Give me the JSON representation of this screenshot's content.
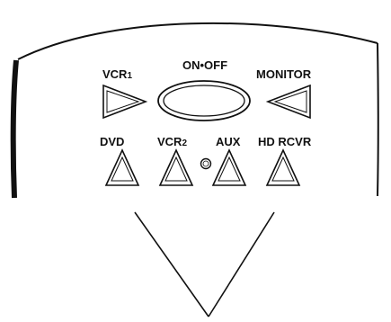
{
  "colors": {
    "ink": "#111111",
    "paper": "#ffffff"
  },
  "remote": {
    "top_row": {
      "left_label_main": "VCR",
      "left_label_sub": "1",
      "center_label": "ON•OFF",
      "right_label": "MONITOR"
    },
    "bottom_row": {
      "label_1": "DVD",
      "label_2_main": "VCR",
      "label_2_sub": "2",
      "label_3": "AUX",
      "label_4": "HD RCVR"
    }
  },
  "buttons": [
    {
      "name": "vcr1-button",
      "icon": "triangle-right"
    },
    {
      "name": "on-off-button",
      "icon": "oval"
    },
    {
      "name": "monitor-button",
      "icon": "triangle-left"
    },
    {
      "name": "dvd-button",
      "icon": "triangle-up"
    },
    {
      "name": "vcr2-button",
      "icon": "triangle-up"
    },
    {
      "name": "indicator-led",
      "icon": "circle"
    },
    {
      "name": "aux-button",
      "icon": "triangle-up"
    },
    {
      "name": "hd-rcvr-button",
      "icon": "triangle-up"
    }
  ]
}
